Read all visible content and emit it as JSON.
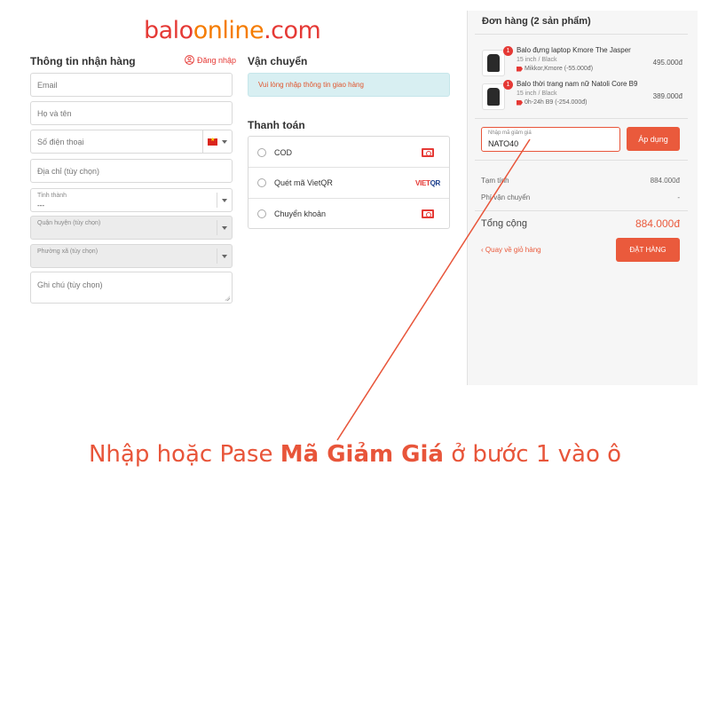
{
  "logo": {
    "part1": "balo",
    "part2": "online",
    "part3": ".com"
  },
  "shipping_info": {
    "title": "Thông tin nhận hàng",
    "login_label": "Đăng nhập",
    "email_placeholder": "Email",
    "name_placeholder": "Họ và tên",
    "phone_placeholder": "Số điện thoại",
    "address_placeholder": "Địa chỉ (tùy chọn)",
    "province_label": "Tỉnh thành",
    "province_value": "---",
    "district_placeholder": "Quận huyện (tùy chọn)",
    "ward_placeholder": "Phường xã (tùy chọn)",
    "note_placeholder": "Ghi chú (tùy chọn)"
  },
  "shipping": {
    "title": "Vận chuyển",
    "message": "Vui lòng nhập thông tin giao hàng"
  },
  "payment": {
    "title": "Thanh toán",
    "options": [
      {
        "label": "COD",
        "icon": "cash-icon"
      },
      {
        "label": "Quét mã VietQR",
        "icon": "vietqr-logo",
        "logo_v": "VIET",
        "logo_rest": "QR"
      },
      {
        "label": "Chuyển khoản",
        "icon": "cash-icon"
      }
    ]
  },
  "order": {
    "title": "Đơn hàng (2 sản phẩm)",
    "items": [
      {
        "qty": "1",
        "name": "Balo đựng laptop Kmore The Jasper",
        "variant": "15 inch / Black",
        "discount": "Mikkor,Kmore (-55.000đ)",
        "price": "495.000đ"
      },
      {
        "qty": "1",
        "name": "Balo thời trang nam nữ Natoli Core B9",
        "variant": "15 inch / Black",
        "discount": "0h-24h B9 (-254.000đ)",
        "price": "389.000đ"
      }
    ],
    "discount_label": "Nhập mã giảm giá",
    "discount_value": "NATO40",
    "apply_label": "Áp dụng",
    "subtotal_label": "Tạm tính",
    "subtotal_value": "884.000đ",
    "shipping_fee_label": "Phí vận chuyển",
    "shipping_fee_value": "-",
    "total_label": "Tổng cộng",
    "total_value": "884.000đ",
    "back_label": "Quay về giỏ hàng",
    "place_order_label": "ĐẶT HÀNG"
  },
  "instruction": {
    "before": "Nhập hoặc Pase ",
    "bold": "Mã Giảm Giá",
    "after": " ở bước 1 vào ô"
  },
  "colors": {
    "accent": "#ea5a3c",
    "logo_red": "#e53935",
    "logo_orange": "#f57c00",
    "info_bg": "#d8eff2"
  }
}
